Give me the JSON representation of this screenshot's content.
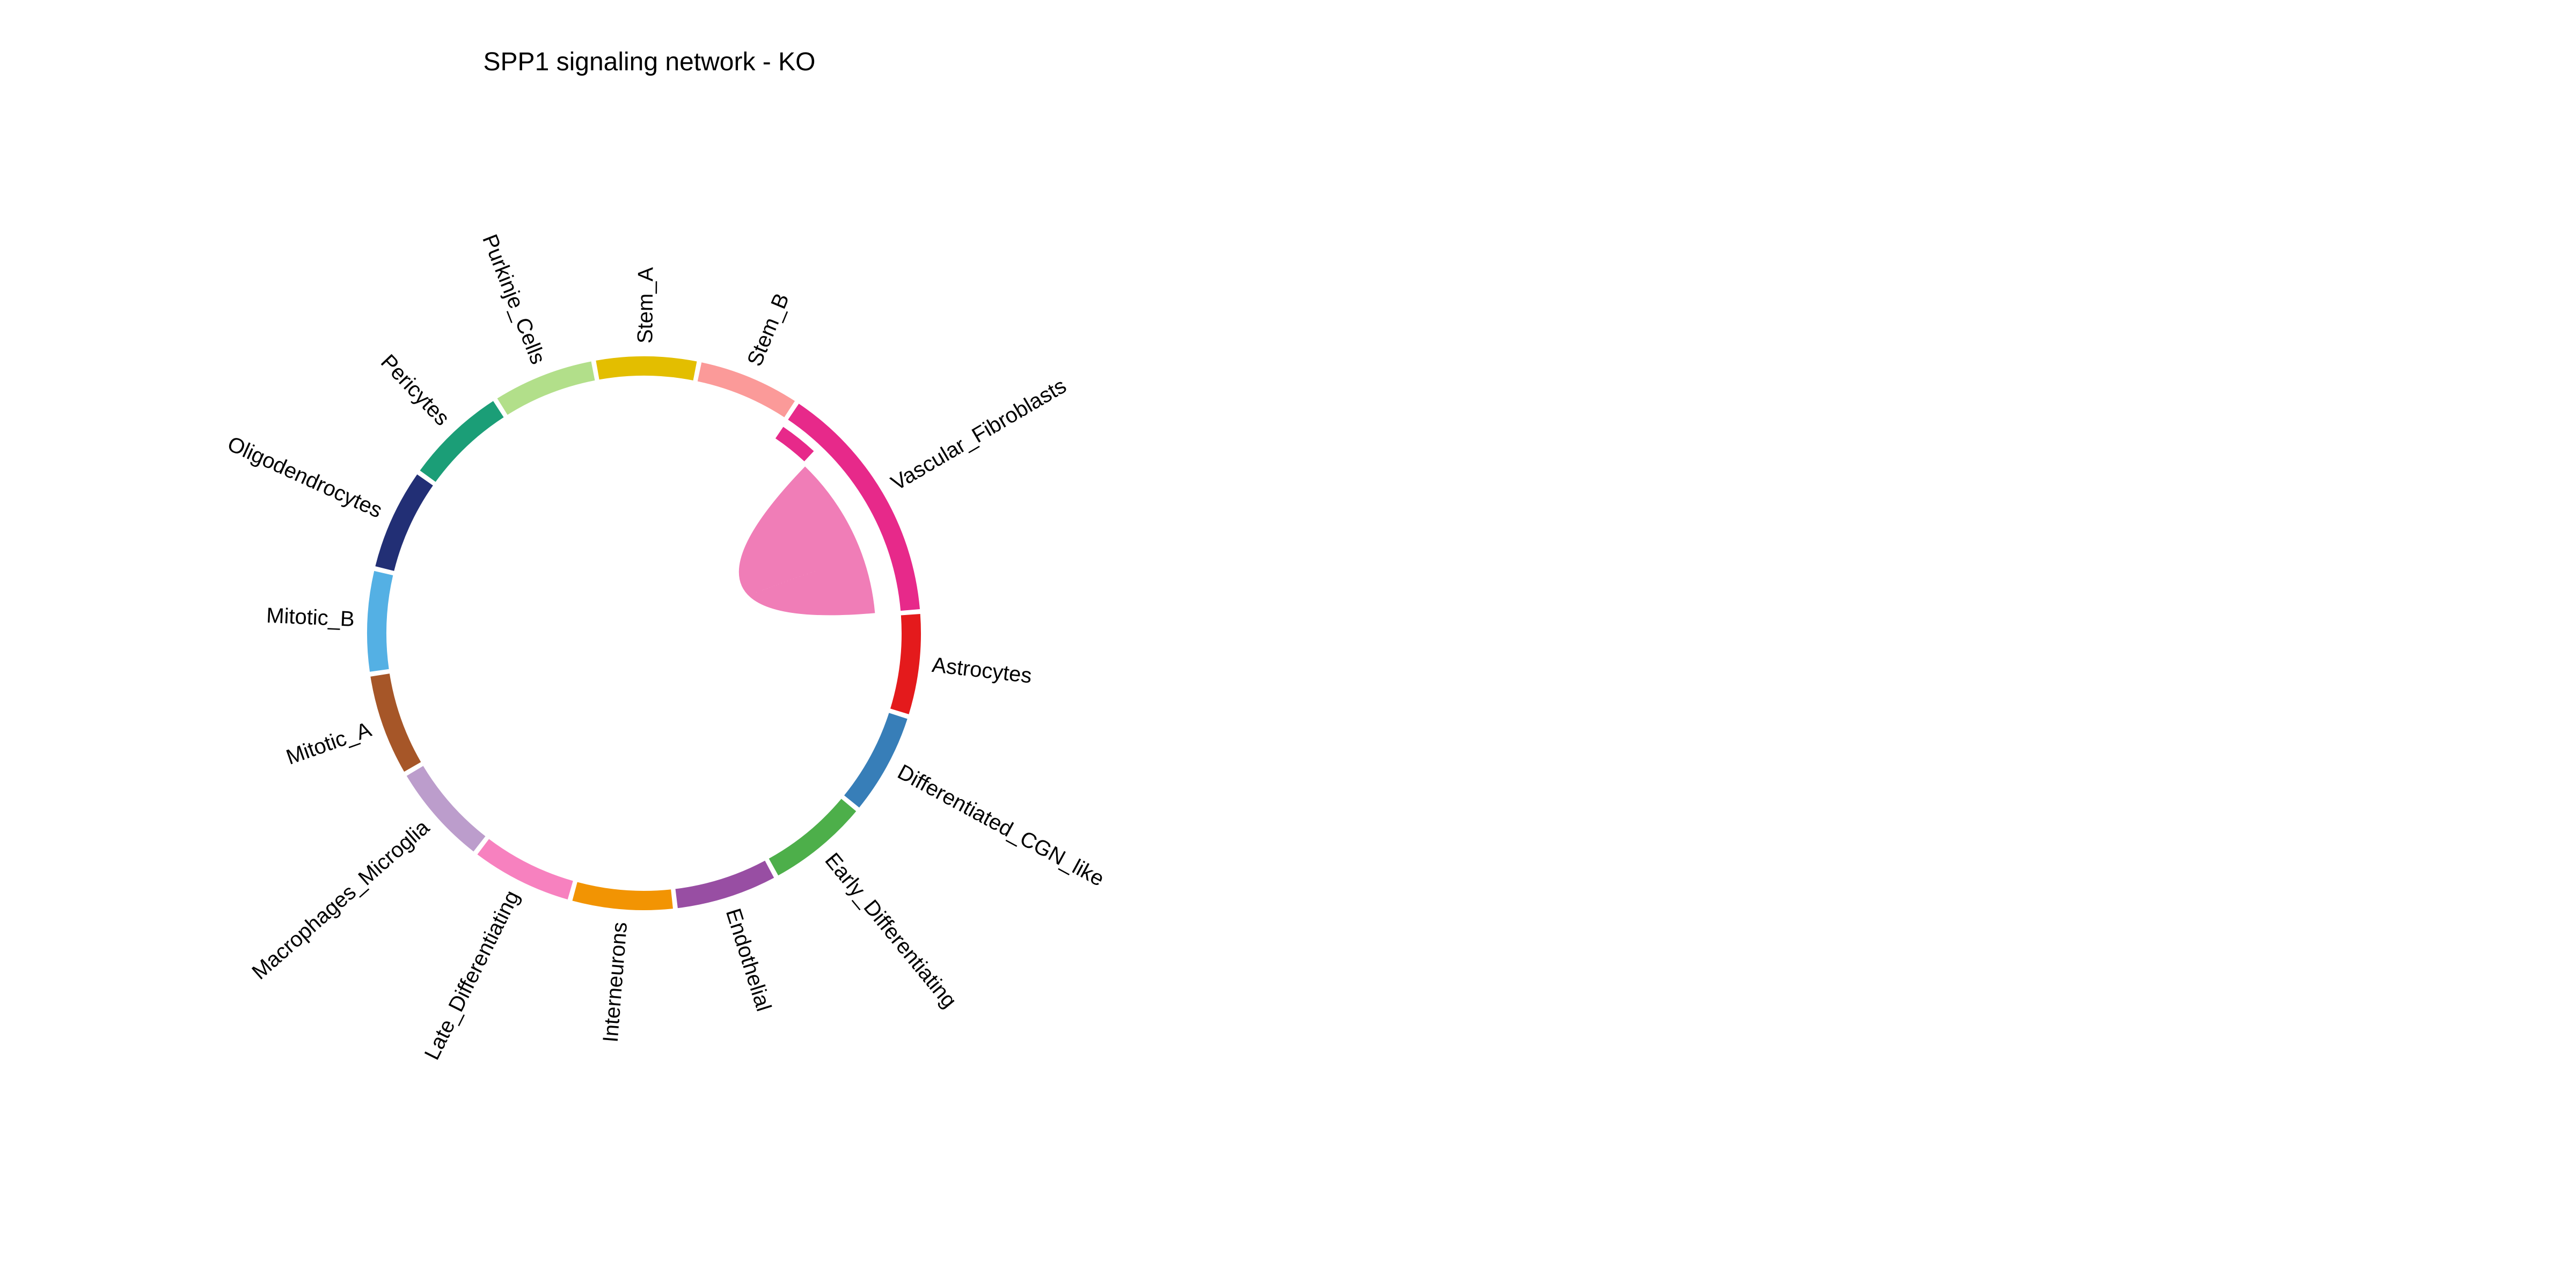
{
  "chart_data": {
    "type": "chord",
    "title": "SPP1 signaling network - KO",
    "segments": [
      {
        "name": "Astrocytes",
        "color": "#E41A1C",
        "start": -4,
        "end": 17
      },
      {
        "name": "Differentiated_CGN_like",
        "color": "#377EB8",
        "start": 18,
        "end": 39
      },
      {
        "name": "Early_Differentiating",
        "color": "#4DAF4A",
        "start": 40,
        "end": 61
      },
      {
        "name": "Endothelial",
        "color": "#984EA3",
        "start": 62,
        "end": 83
      },
      {
        "name": "Interneurons",
        "color": "#F29403",
        "start": 84,
        "end": 105
      },
      {
        "name": "Late_Differentiating",
        "color": "#F781BF",
        "start": 106,
        "end": 127
      },
      {
        "name": "Macrophages_Microglia",
        "color": "#BC9DCC",
        "start": 128,
        "end": 149
      },
      {
        "name": "Mitotic_A",
        "color": "#A65628",
        "start": 150,
        "end": 171
      },
      {
        "name": "Mitotic_B",
        "color": "#54B0E4",
        "start": 172,
        "end": 193
      },
      {
        "name": "Oligodendrocytes",
        "color": "#222F75",
        "start": 194,
        "end": 215
      },
      {
        "name": "Pericytes",
        "color": "#1B9E77",
        "start": 216,
        "end": 237
      },
      {
        "name": "Purkinje_Cells",
        "color": "#B2DF8A",
        "start": 238,
        "end": 259
      },
      {
        "name": "Stem_A",
        "color": "#E3BE00",
        "start": 260,
        "end": 281
      },
      {
        "name": "Stem_B",
        "color": "#FB9A99",
        "start": 282,
        "end": 303
      },
      {
        "name": "Vascular_Fibroblasts",
        "color": "#E7298A",
        "start": 304,
        "end": 355
      }
    ],
    "inner_bars": [
      {
        "segment": "Vascular_Fibroblasts",
        "color": "#E7298A",
        "start": 304,
        "end": 313
      }
    ],
    "links": [
      {
        "source": "Vascular_Fibroblasts",
        "target": "Vascular_Fibroblasts",
        "color": "#F07DB7",
        "source_range": [
          314,
          340
        ],
        "target_range": [
          340,
          355
        ]
      }
    ]
  }
}
